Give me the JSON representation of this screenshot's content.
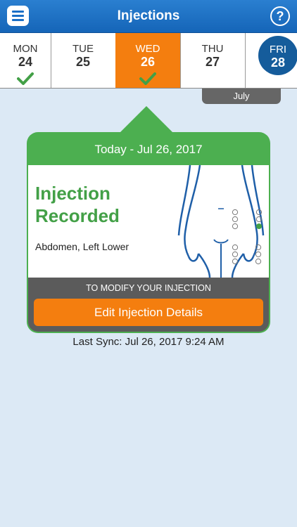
{
  "header": {
    "title": "Injections",
    "help": "?"
  },
  "days": [
    {
      "name": "MON",
      "num": "24",
      "checked": true
    },
    {
      "name": "TUE",
      "num": "25",
      "checked": false
    },
    {
      "name": "WED",
      "num": "26",
      "checked": true,
      "active": true
    },
    {
      "name": "THU",
      "num": "27",
      "checked": false
    },
    {
      "name": "FRI",
      "num": "28",
      "today": true
    }
  ],
  "month": "July",
  "card": {
    "date": "Today - Jul 26, 2017",
    "status_line1": "Injection",
    "status_line2": "Recorded",
    "site": "Abdomen, Left Lower",
    "modify": "TO MODIFY YOUR INJECTION",
    "edit_button": "Edit Injection Details"
  },
  "last_sync": "Last Sync: Jul 26, 2017 9:24 AM",
  "colors": {
    "header_blue": "#1a6fc6",
    "active_orange": "#f47e0f",
    "green": "#4caf50",
    "today_circle": "#155c9b"
  }
}
